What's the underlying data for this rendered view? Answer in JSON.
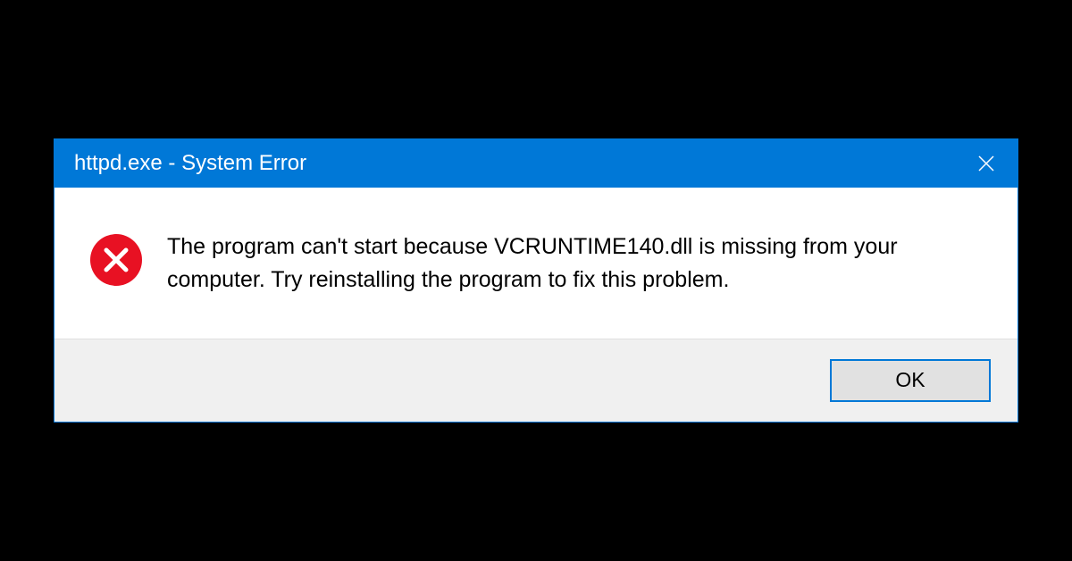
{
  "dialog": {
    "title": "httpd.exe - System Error",
    "message": "The program can't start because VCRUNTIME140.dll is missing from your computer. Try reinstalling the program to fix this problem.",
    "ok_label": "OK"
  }
}
